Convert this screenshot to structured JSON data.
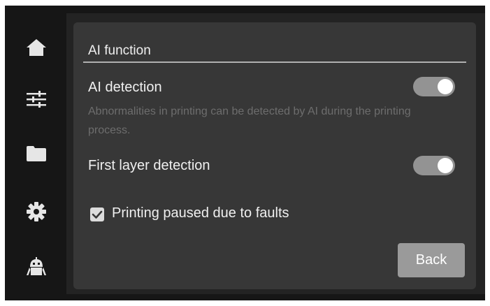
{
  "sidebar": {
    "items": [
      {
        "icon": "home-icon"
      },
      {
        "icon": "sliders-icon"
      },
      {
        "icon": "folder-icon"
      },
      {
        "icon": "gear-icon"
      },
      {
        "icon": "robot-icon"
      }
    ]
  },
  "panel": {
    "title": "AI function",
    "ai_detection": {
      "label": "AI detection",
      "description": "Abnormalities in printing can be detected by AI during the printing process.",
      "enabled": true
    },
    "first_layer": {
      "label": "First layer detection",
      "enabled": true
    },
    "pause_on_faults": {
      "label": "Printing paused due to faults",
      "checked": true
    },
    "back_label": "Back"
  },
  "colors": {
    "background": "#161616",
    "panel": "#373737",
    "toggle_on": "#939393",
    "button": "#9a9a9a"
  }
}
